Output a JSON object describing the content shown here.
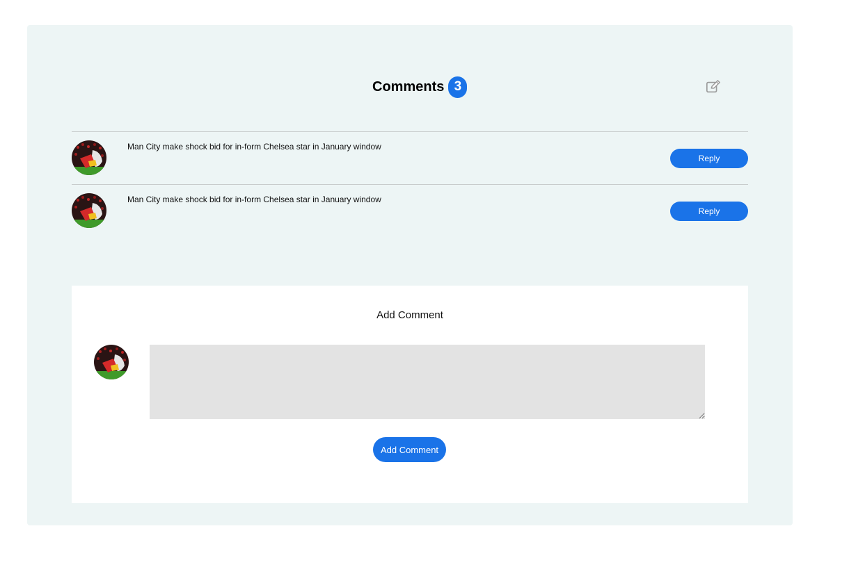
{
  "header": {
    "title": "Comments",
    "count": "3"
  },
  "comments": [
    {
      "text": "Man City make shock bid for in-form Chelsea star in January window",
      "reply_label": "Reply"
    },
    {
      "text": "Man City make shock bid for in-form Chelsea star in January window",
      "reply_label": "Reply"
    }
  ],
  "add_comment": {
    "title": "Add Comment",
    "input_value": "",
    "submit_label": "Add Comment"
  },
  "colors": {
    "accent": "#1a73e8",
    "panel_bg": "#edf5f5",
    "input_bg": "#e3e3e3"
  },
  "icons": {
    "edit": "edit-icon",
    "avatar": "avatar-image"
  }
}
